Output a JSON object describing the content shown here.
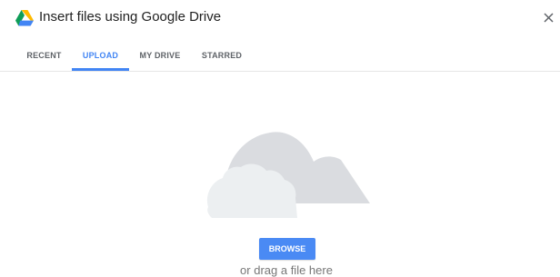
{
  "header": {
    "title": "Insert files using Google Drive",
    "logo_icon": "google-drive-icon",
    "close_icon": "close-icon"
  },
  "tabs": [
    {
      "label": "RECENT",
      "active": false
    },
    {
      "label": "UPLOAD",
      "active": true
    },
    {
      "label": "MY DRIVE",
      "active": false
    },
    {
      "label": "STARRED",
      "active": false
    }
  ],
  "upload": {
    "illustration_icon": "cloud-icon",
    "browse_label": "BROWSE",
    "drag_text": "or drag a file here"
  },
  "colors": {
    "accent": "#4285f4",
    "button": "#4a8af4",
    "cloud_back": "#dadce0",
    "cloud_front": "#eceff1"
  }
}
